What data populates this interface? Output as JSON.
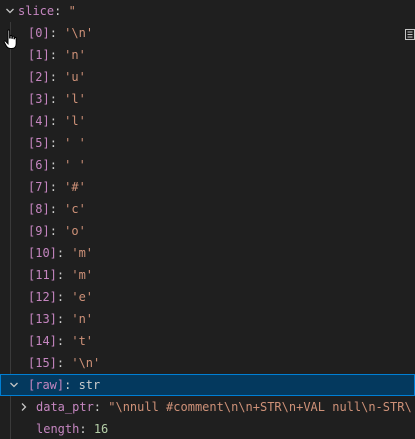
{
  "root": {
    "key": "slice",
    "sep": ": ",
    "value": "\""
  },
  "items": [
    {
      "key": "[0]",
      "sep": ": ",
      "value": "'\\n'"
    },
    {
      "key": "[1]",
      "sep": ": ",
      "value": "'n'"
    },
    {
      "key": "[2]",
      "sep": ": ",
      "value": "'u'"
    },
    {
      "key": "[3]",
      "sep": ": ",
      "value": "'l'"
    },
    {
      "key": "[4]",
      "sep": ": ",
      "value": "'l'"
    },
    {
      "key": "[5]",
      "sep": ": ",
      "value": "' '"
    },
    {
      "key": "[6]",
      "sep": ": ",
      "value": "' '"
    },
    {
      "key": "[7]",
      "sep": ": ",
      "value": "'#'"
    },
    {
      "key": "[8]",
      "sep": ": ",
      "value": "'c'"
    },
    {
      "key": "[9]",
      "sep": ": ",
      "value": "'o'"
    },
    {
      "key": "[10]",
      "sep": ": ",
      "value": "'m'"
    },
    {
      "key": "[11]",
      "sep": ": ",
      "value": "'m'"
    },
    {
      "key": "[12]",
      "sep": ": ",
      "value": "'e'"
    },
    {
      "key": "[13]",
      "sep": ": ",
      "value": "'n'"
    },
    {
      "key": "[14]",
      "sep": ": ",
      "value": "'t'"
    },
    {
      "key": "[15]",
      "sep": ": ",
      "value": "'\\n'"
    }
  ],
  "raw": {
    "key": "[raw]",
    "sep": ": ",
    "value": "str"
  },
  "data_ptr": {
    "key": "data_ptr",
    "sep": ": ",
    "value": "\"\\nnull  #comment\\n\\n+STR\\n+VAL null\\n-STR\\"
  },
  "length": {
    "key": "length",
    "sep": ": ",
    "value": "16"
  },
  "colors": {
    "background": "#1f1f1f",
    "selected": "#04395e",
    "key": "#c586c0",
    "string": "#ce9178",
    "number": "#b5cea8"
  }
}
